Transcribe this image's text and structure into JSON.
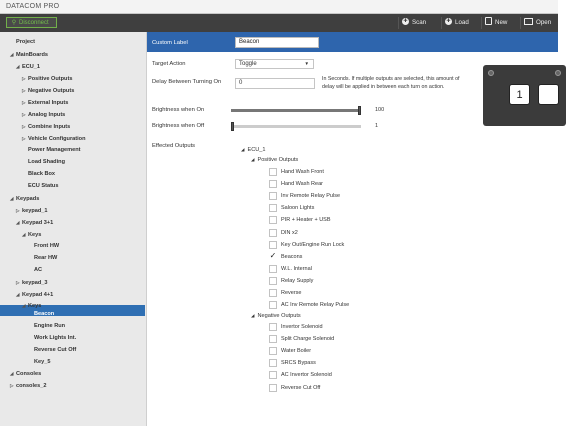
{
  "window": {
    "title": "DATACOM PRO"
  },
  "toolbar": {
    "disconnect_label": "Disconnect",
    "scan_label": "Scan",
    "load_label": "Load",
    "new_label": "New",
    "open_label": "Open"
  },
  "sidebar": {
    "items": [
      {
        "label": "Project",
        "arrow": ""
      },
      {
        "label": "MainBoards",
        "arrow": "◢"
      },
      {
        "label": "ECU_1",
        "arrow": "◢"
      },
      {
        "label": "Positive Outputs",
        "arrow": "▷"
      },
      {
        "label": "Negative Outputs",
        "arrow": "▷"
      },
      {
        "label": "External Inputs",
        "arrow": "▷"
      },
      {
        "label": "Analog Inputs",
        "arrow": "▷"
      },
      {
        "label": "Combine Inputs",
        "arrow": "▷"
      },
      {
        "label": "Vehicle Configuration",
        "arrow": "▷"
      },
      {
        "label": "Power Management",
        "arrow": ""
      },
      {
        "label": "Load Shading",
        "arrow": ""
      },
      {
        "label": "Black Box",
        "arrow": ""
      },
      {
        "label": "ECU Status",
        "arrow": ""
      },
      {
        "label": "Keypads",
        "arrow": "◢"
      },
      {
        "label": "keypad_1",
        "arrow": "▷"
      },
      {
        "label": "Keypad 3+1",
        "arrow": "◢"
      },
      {
        "label": "Keys",
        "arrow": "◢"
      },
      {
        "label": "Front HW",
        "arrow": ""
      },
      {
        "label": "Rear HW",
        "arrow": ""
      },
      {
        "label": "AC",
        "arrow": ""
      },
      {
        "label": "keypad_3",
        "arrow": "▷"
      },
      {
        "label": "Keypad 4+1",
        "arrow": "◢"
      },
      {
        "label": "Keys",
        "arrow": "◢"
      },
      {
        "label": "Beacon",
        "arrow": ""
      },
      {
        "label": "Engine Run",
        "arrow": ""
      },
      {
        "label": "Work Lights Int.",
        "arrow": ""
      },
      {
        "label": "Reverse Cut Off",
        "arrow": ""
      },
      {
        "label": "Key_5",
        "arrow": ""
      },
      {
        "label": "Consoles",
        "arrow": "◢"
      },
      {
        "label": "consoles_2",
        "arrow": "▷"
      }
    ]
  },
  "form": {
    "custom_label_label": "Custom Label",
    "custom_label_value": "Beacon",
    "target_action_label": "Target Action",
    "target_action_value": "Toggle",
    "delay_label": "Delay Between Turning On",
    "delay_value": "0",
    "delay_hint": "In Seconds. If multiple outputs are selected, this amount of delay will be applied in between each turn on action.",
    "brightness_on_label": "Brightness when On",
    "brightness_on_value": "100",
    "brightness_on_level": 1.0,
    "brightness_off_label": "Brightness when Off",
    "brightness_off_value": "1",
    "brightness_off_level": 0.01,
    "effected_outputs_label": "Effected Outputs"
  },
  "outputs": {
    "root_label": "ECU_1",
    "positive_label": "Positive Outputs",
    "positive": [
      {
        "label": "Hand Wash Front",
        "checked": false
      },
      {
        "label": "Hand Wash Rear",
        "checked": false
      },
      {
        "label": "Inv Remote Relay Pulse",
        "checked": false
      },
      {
        "label": "Saloon Lights",
        "checked": false
      },
      {
        "label": "PIR + Heater + USB",
        "checked": false
      },
      {
        "label": "DIN x2",
        "checked": false
      },
      {
        "label": "Key Out/Engine Run Lock",
        "checked": false
      },
      {
        "label": "Beacons",
        "checked": true
      },
      {
        "label": "W.L. Internal",
        "checked": false
      },
      {
        "label": "Relay Supply",
        "checked": false
      },
      {
        "label": "Reverse",
        "checked": false
      },
      {
        "label": "AC Inv Remote Relay Pulse",
        "checked": false
      }
    ],
    "negative_label": "Negative Outputs",
    "negative": [
      {
        "label": "Invertor Solenoid",
        "checked": false
      },
      {
        "label": "Split Charge Solenoid",
        "checked": false
      },
      {
        "label": "Water Boiler",
        "checked": false
      },
      {
        "label": "SRCS Bypass",
        "checked": false
      },
      {
        "label": "AC Invertor Solenoid",
        "checked": false
      },
      {
        "label": "Reverse Cut Off",
        "checked": false
      }
    ]
  },
  "keypad_preview": {
    "key_number": "1"
  },
  "colors": {
    "accent": "#2e65ad",
    "toolbar": "#3f3f3f",
    "sidebar": "#e9e9e9"
  }
}
